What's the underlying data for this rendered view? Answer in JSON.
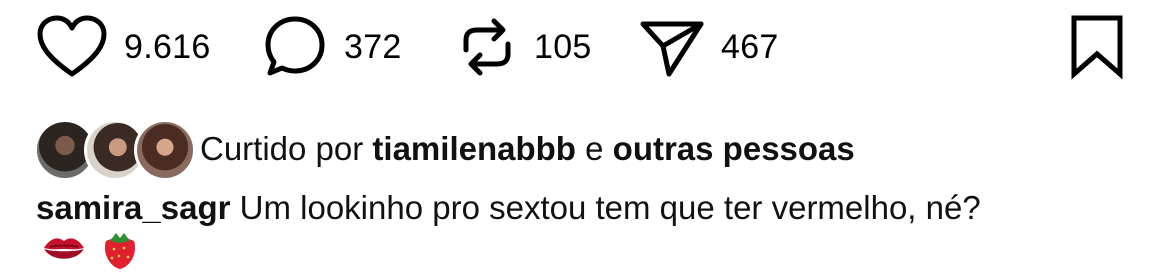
{
  "actions": {
    "like_count": "9.616",
    "comment_count": "372",
    "repost_count": "105",
    "share_count": "467"
  },
  "icons": {
    "like": "heart-icon",
    "comment": "comment-bubble-icon",
    "repost": "repost-icon",
    "share": "send-icon",
    "save": "bookmark-icon"
  },
  "liked_by": {
    "prefix": "Curtido por",
    "user": "tiamilenabbb",
    "conjunction": "e",
    "others": "outras pessoas"
  },
  "caption": {
    "username": "samira_sagr",
    "text": "Um lookinho pro sextou tem que ter vermelho, né?",
    "emojis": [
      "💋",
      "🍓"
    ]
  }
}
